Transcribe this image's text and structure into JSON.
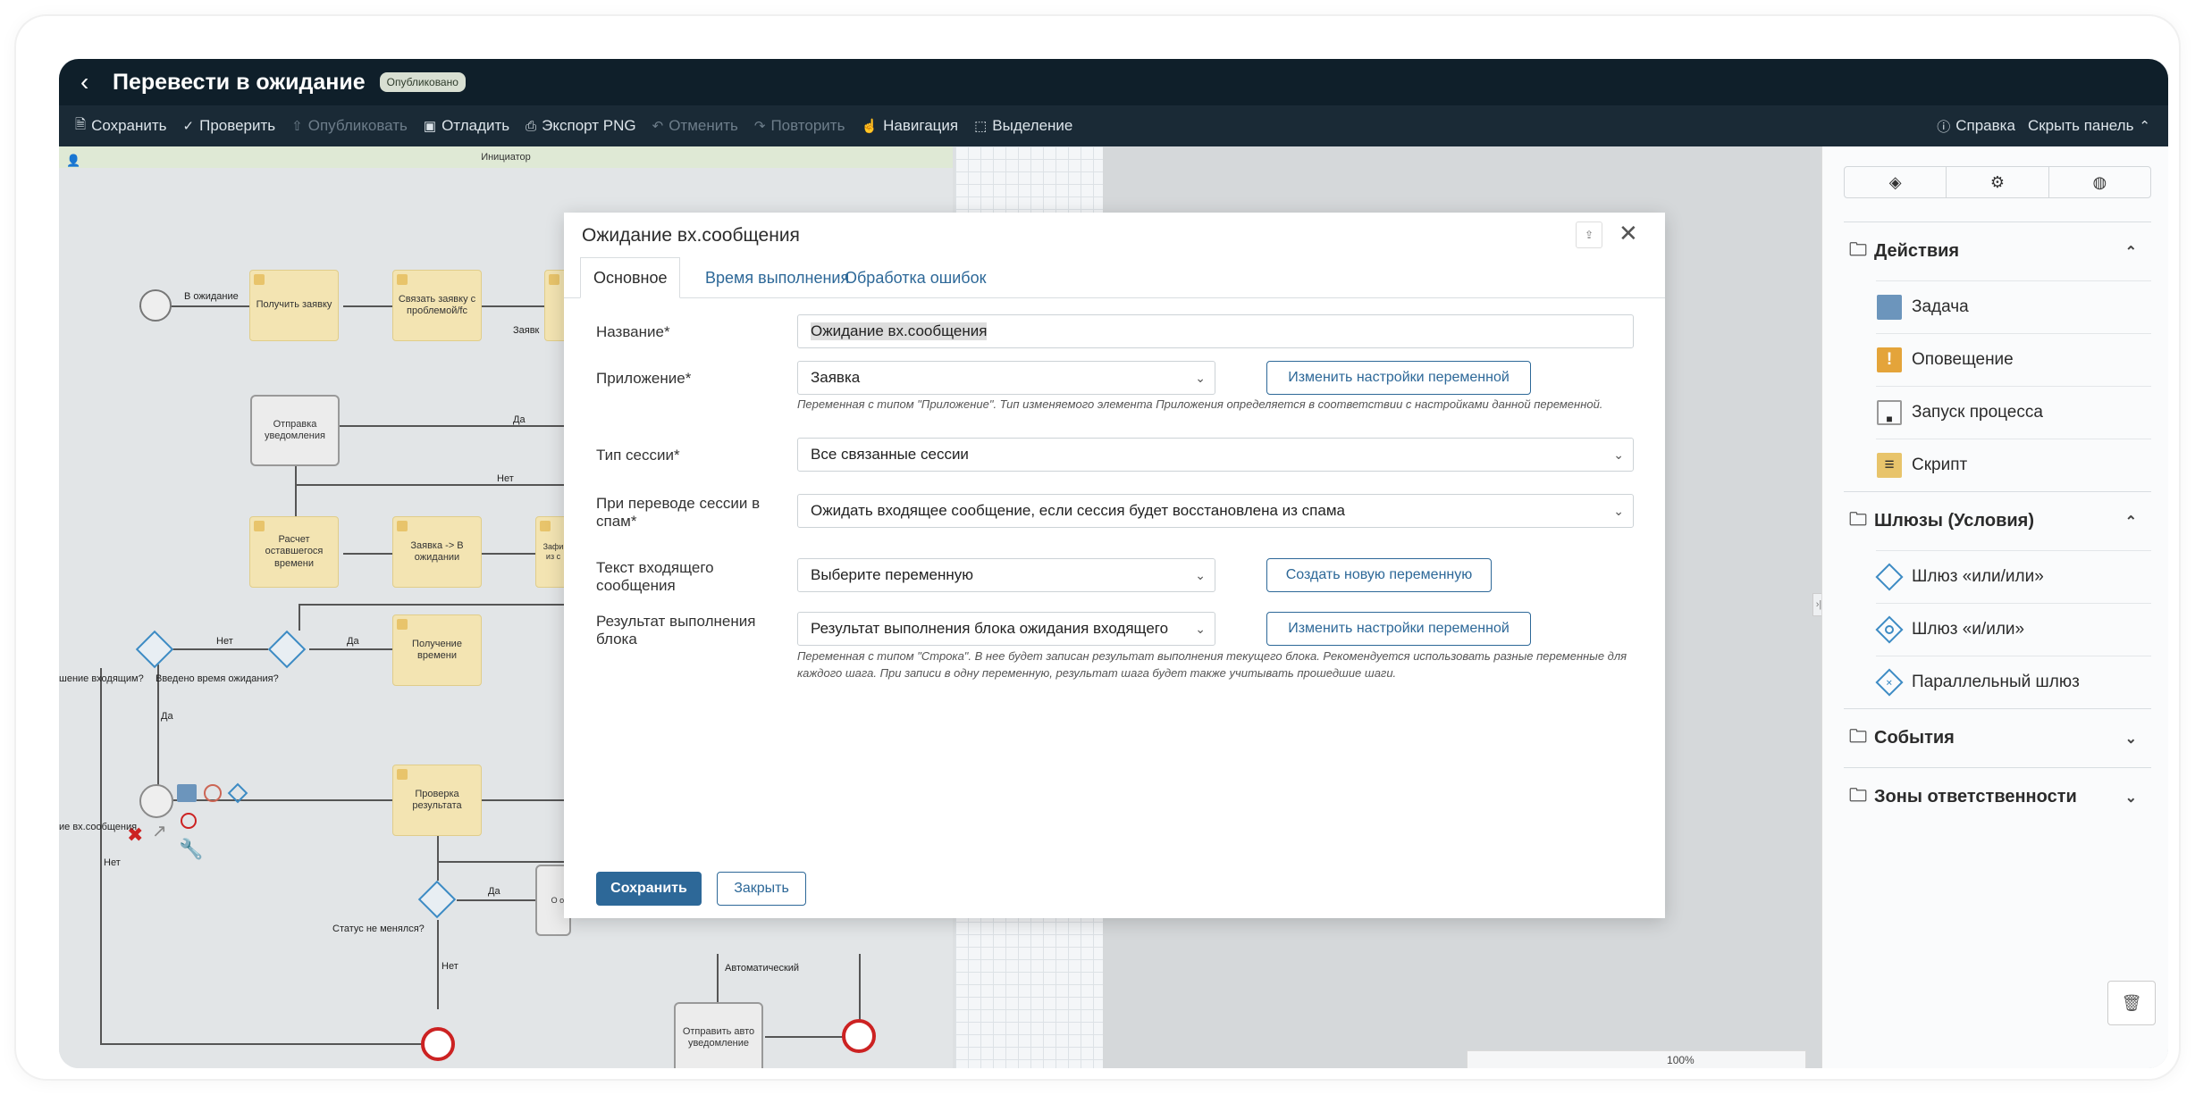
{
  "header": {
    "back_icon": "chevron-left-icon",
    "title": "Перевести в ожидание",
    "badge": "Опубликовано"
  },
  "toolbar": {
    "items": [
      {
        "label": "Сохранить",
        "icon": "save-icon",
        "enabled": true
      },
      {
        "label": "Проверить",
        "icon": "check-icon",
        "enabled": true
      },
      {
        "label": "Опубликовать",
        "icon": "publish-icon",
        "enabled": false
      },
      {
        "label": "Отладить",
        "icon": "debug-icon",
        "enabled": true
      },
      {
        "label": "Экспорт PNG",
        "icon": "print-icon",
        "enabled": true
      },
      {
        "label": "Отменить",
        "icon": "undo-icon",
        "enabled": false
      },
      {
        "label": "Повторить",
        "icon": "redo-icon",
        "enabled": false
      },
      {
        "label": "Навигация",
        "icon": "hand-icon",
        "enabled": true
      },
      {
        "label": "Выделение",
        "icon": "select-icon",
        "enabled": true
      }
    ],
    "help": "Справка",
    "hide_panel": "Скрыть панель"
  },
  "diagram": {
    "lane": "Инициатор",
    "start_label": "В ожидание",
    "nodes": {
      "n1": "Получить заявку",
      "n2": "Связать заявку с проблемой/fc",
      "n3": "Отправка уведомления",
      "n4": "Расчет оставшегося времени",
      "n5": "Заявка -> В ожидании",
      "n6": "Получение времени",
      "n7": "Проверка результата",
      "n8": "Отправить авто уведомление"
    },
    "labels": {
      "yes1": "Да",
      "no1": "Нет",
      "zayavk": "Заявк",
      "no2": "Нет",
      "yes2": "Да",
      "q1": "шение входящим?",
      "q2": "Введено время ожидания?",
      "yes3": "Да",
      "wait": "ие вх.сообщения",
      "no3": "Нет",
      "yes4": "Да",
      "q3": "Статус не менялся?",
      "no4": "Нет",
      "auto": "Автоматический",
      "partial1": "Зафи из с",
      "partial2": "О ож"
    }
  },
  "modal": {
    "title": "Ожидание вх.сообщения",
    "tabs": [
      "Основное",
      "Время выполнения",
      "Обработка ошибок"
    ],
    "fields": {
      "name_label": "Название*",
      "name_value": "Ожидание вх.сообщения",
      "app_label": "Приложение*",
      "app_value": "Заявка",
      "app_btn": "Изменить настройки переменной",
      "app_hint": "Переменная с типом \"Приложение\". Тип изменяемого элемента Приложения определяется в соответствии с настройками данной переменной.",
      "session_label": "Тип сессии*",
      "session_value": "Все связанные сессии",
      "spam_label": "При переводе сессии в спам*",
      "spam_value": "Ожидать входящее сообщение, если сессия будет восстановлена из спама",
      "text_label": "Текст входящего сообщения",
      "text_value": "Выберите переменную",
      "text_btn": "Создать новую переменную",
      "result_label": "Результат выполнения блока",
      "result_value": "Результат выполнения блока ожидания входящего",
      "result_btn": "Изменить настройки переменной",
      "result_hint": "Переменная с типом \"Строка\". В нее будет записан результат выполнения текущего блока. Рекомендуется использовать разные переменные для каждого шага. При записи в одну переменную, результат шага будет также учитывать прошедшие шаги."
    },
    "save": "Сохранить",
    "close": "Закрыть"
  },
  "panel": {
    "tabs": [
      "diamond-icon",
      "gear-icon",
      "palette-icon"
    ],
    "sections": [
      {
        "title": "Действия",
        "expanded": true,
        "items": [
          "Задача",
          "Оповещение",
          "Запуск процесса",
          "Скрипт"
        ]
      },
      {
        "title": "Шлюзы (Условия)",
        "expanded": true,
        "items": [
          "Шлюз «или/или»",
          "Шлюз «и/или»",
          "Параллельный шлюз"
        ]
      },
      {
        "title": "События",
        "expanded": false,
        "items": []
      },
      {
        "title": "Зоны ответственности",
        "expanded": false,
        "items": []
      }
    ]
  },
  "zoom": {
    "level": "100%",
    "value": 0.55
  },
  "colors": {
    "accent": "#2d6898",
    "header": "#0f1f2a",
    "toolbar": "#1a2a36",
    "task": "#f3e4b2",
    "gateway": "#3d8bc4",
    "end_event": "#cc2222"
  }
}
